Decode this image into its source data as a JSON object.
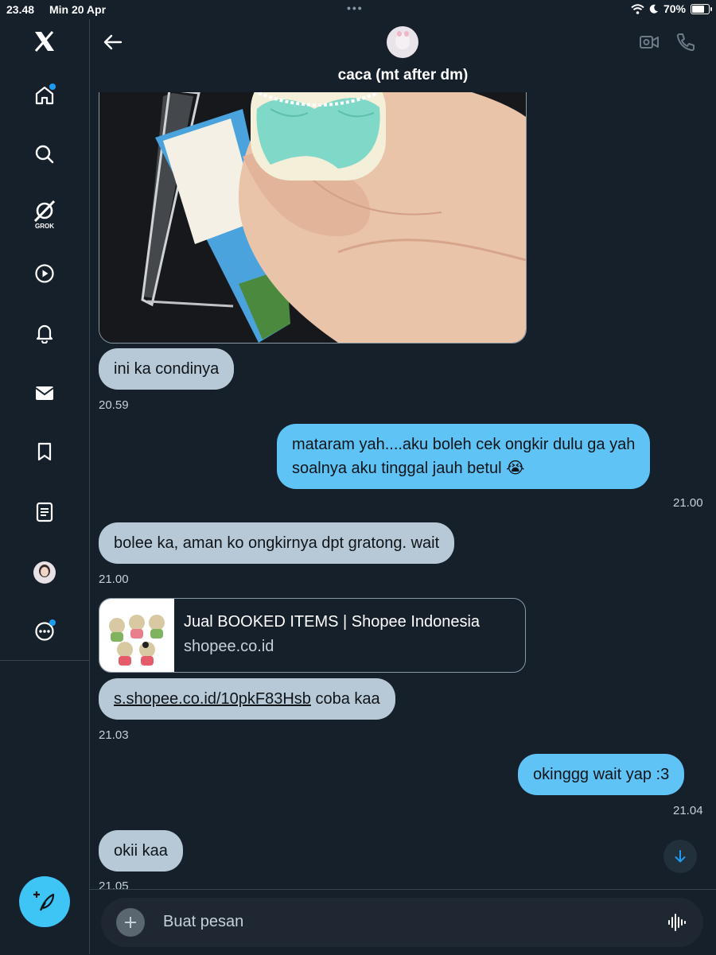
{
  "status_bar": {
    "time": "23.48",
    "date": "Min 20 Apr",
    "dots": "•••",
    "battery": "70%",
    "battery_level": 0.7
  },
  "sidebar": {
    "items": [
      {
        "name": "x-logo",
        "icon": "x-logo-icon"
      },
      {
        "name": "home",
        "icon": "home-icon",
        "badge": true
      },
      {
        "name": "search",
        "icon": "search-icon"
      },
      {
        "name": "grok",
        "icon": "grok-icon",
        "label": "GROK"
      },
      {
        "name": "video",
        "icon": "play-icon"
      },
      {
        "name": "notifications",
        "icon": "bell-icon"
      },
      {
        "name": "messages",
        "icon": "envelope-icon"
      },
      {
        "name": "bookmarks",
        "icon": "bookmark-icon"
      },
      {
        "name": "lists",
        "icon": "list-icon"
      },
      {
        "name": "profile",
        "icon": "avatar-icon"
      },
      {
        "name": "more",
        "icon": "more-icon",
        "badge": true
      }
    ],
    "compose_icon": "feather-plus-icon"
  },
  "header": {
    "title": "caca (mt after dm)"
  },
  "messages": [
    {
      "side": "in",
      "text": "ini ka condinya",
      "time": "20.59"
    },
    {
      "side": "out",
      "lines": [
        "mataram yah....aku boleh cek ongkir dulu ga yah",
        "soalnya aku tinggal jauh betul 😭"
      ],
      "time": "21.00"
    },
    {
      "side": "in",
      "text": "bolee ka, aman ko ongkirnya dpt gratong. wait",
      "time": "21.00"
    },
    {
      "side": "in",
      "link": "s.shopee.co.id/10pkF83Hsb",
      "text": " coba kaa",
      "time": "21.03"
    },
    {
      "side": "out",
      "text": "okinggg wait yap :3",
      "time": "21.04"
    },
    {
      "side": "in",
      "text": "okii kaa",
      "time": "21.05"
    }
  ],
  "link_card": {
    "title": "Jual BOOKED ITEMS | Shopee Indonesia",
    "domain": "shopee.co.id"
  },
  "composer": {
    "placeholder": "Buat pesan"
  },
  "colors": {
    "background": "#15202b",
    "incoming_bubble": "#b7c9d6",
    "outgoing_bubble": "#5fc3f6",
    "accent": "#1d9bf0"
  }
}
